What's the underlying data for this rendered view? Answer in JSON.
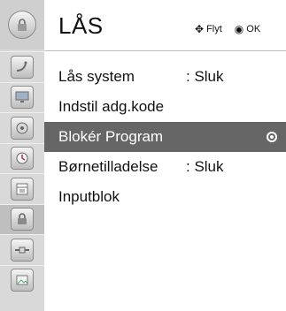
{
  "header": {
    "title": "LÅS",
    "hints": [
      {
        "icon": "move-arrows-icon",
        "glyph": "✥",
        "label": "Flyt"
      },
      {
        "icon": "ok-dot-icon",
        "glyph": "◉",
        "label": "OK"
      }
    ]
  },
  "sidebar": {
    "top_icon": "lock-icon",
    "items": [
      {
        "icon": "satellite-dish-icon"
      },
      {
        "icon": "tv-icon"
      },
      {
        "icon": "speaker-icon"
      },
      {
        "icon": "clock-icon"
      },
      {
        "icon": "calendar-icon"
      },
      {
        "icon": "lock-icon",
        "active": true
      },
      {
        "icon": "cable-icon"
      },
      {
        "icon": "photo-icon"
      }
    ]
  },
  "menu": {
    "items": [
      {
        "label": "Lås system",
        "value": ": Sluk"
      },
      {
        "label": "Indstil adg.kode",
        "value": ""
      },
      {
        "label": "Blokér Program",
        "value": "",
        "selected": true
      },
      {
        "label": "Børnetilladelse",
        "value": ": Sluk"
      },
      {
        "label": "Inputblok",
        "value": ""
      }
    ]
  },
  "colors": {
    "selected_row": "#666666",
    "rail_bg": "#d9d9d9",
    "active_rail": "#bfbfbf"
  }
}
